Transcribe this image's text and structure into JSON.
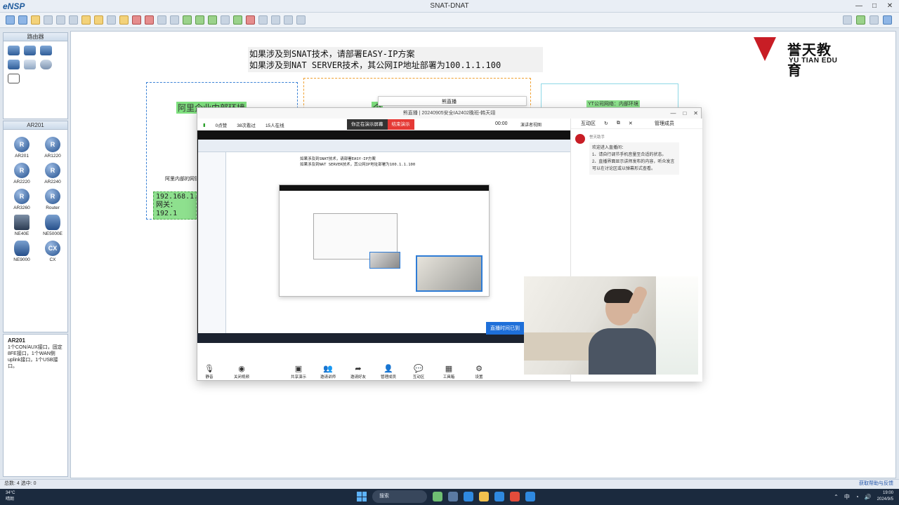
{
  "app": {
    "logo": "eNSP",
    "window_title": "SNAT-DNAT"
  },
  "window_buttons": [
    "—",
    "□",
    "✕"
  ],
  "left": {
    "category_header": "路由器",
    "device_header": "AR201",
    "devices": [
      {
        "label": "AR201",
        "glyph": "R"
      },
      {
        "label": "AR1220",
        "glyph": "R"
      },
      {
        "label": "AR2220",
        "glyph": "R"
      },
      {
        "label": "AR2240",
        "glyph": "R"
      },
      {
        "label": "AR3260",
        "glyph": "R"
      },
      {
        "label": "Router",
        "glyph": "R"
      },
      {
        "label": "NE40E",
        "glyph": ""
      },
      {
        "label": "NE5000E",
        "glyph": ""
      },
      {
        "label": "NE9000",
        "glyph": ""
      },
      {
        "label": "CX",
        "glyph": "CX"
      }
    ],
    "desc_title": "AR201",
    "desc_text": "1个CON/AUX接口，固定8FE接口，1个WAN侧uplink接口，1个USB接口。"
  },
  "canvas": {
    "note_line1": "如果涉及到SNAT技术，请部署EASY-IP方案",
    "note_line2": "如果涉及到NAT SERVER技术，其公网IP地址部署为100.1.1.100",
    "brand_cn": "誉天教育",
    "brand_en": "YU TIAN EDU",
    "zone_left_label": "阿里企业内部环境",
    "zone_left_sub": "阿里内部的网管",
    "zone_mid_label": "企",
    "zone_right_label": "YT公司网络：内部环境",
    "ip_line1": "192.168.1.1",
    "ip_line2": "网关：192.1",
    "popup_title": "熊直播"
  },
  "live": {
    "title": "熊直播 | 20240905安全IA2402晚班-韩天翊",
    "stats": [
      "0点赞",
      "38次看过",
      "15人在线"
    ],
    "presenting": "你正在演示屏幕",
    "stop": "结束演示",
    "time": "00:00",
    "view_mode": "演讲者视图",
    "inner_note1": "如果涉及到SNAT技术，请部署EASY-IP方案",
    "inner_note2": "如果涉及到NAT SERVER技术，其公网IP地址部署为100.1.1.100",
    "tip": "直播时间已到",
    "controls": [
      "静音",
      "关闭视频",
      "共享演示",
      "邀请讲师",
      "邀请好友",
      "管理成员",
      "互动区",
      "工具箱",
      "设置"
    ],
    "side_tab": "互动区",
    "side_mgr": "管理成员",
    "msg_sender": "誉天助手",
    "msg_text": [
      "欢迎进入直播间：",
      "1、请自行调节手机音量至合适的状态。",
      "2、直播界面显示讲师发布的内容，听众发言可以在讨论区或以弹幕形式查看。"
    ]
  },
  "status": {
    "left": "总数: 4  选中: 0",
    "right": "获取帮助与反馈"
  },
  "taskbar": {
    "weather_temp": "34°C",
    "weather_desc": "晴朗",
    "search": "搜索",
    "tray_lang": "中",
    "time": "19:00",
    "date": "2024/9/5"
  }
}
